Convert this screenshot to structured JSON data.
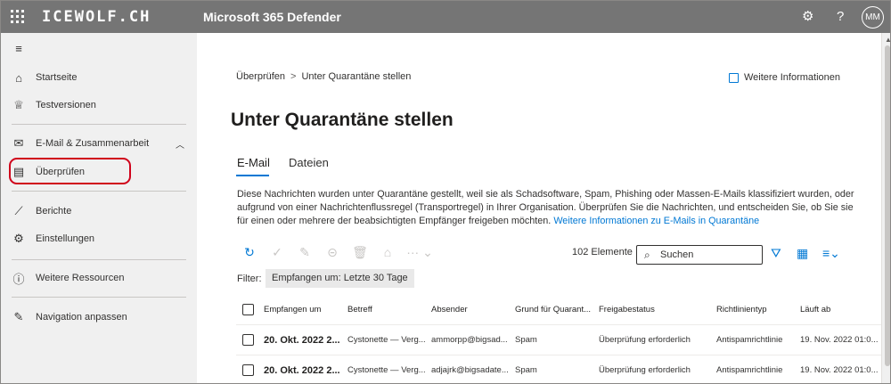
{
  "topbar": {
    "brand": "ICEWOLF.CH",
    "app_title": "Microsoft 365 Defender",
    "help_glyph": "?",
    "avatar_initials": "MM"
  },
  "sidebar": {
    "items": [
      {
        "label": "Startseite",
        "icon": "home-icon"
      },
      {
        "label": "Testversionen",
        "icon": "trophy-icon"
      },
      {
        "label": "E-Mail & Zusammenarbeit",
        "icon": "mail-icon"
      },
      {
        "label": "Überprüfen",
        "icon": "document-icon"
      },
      {
        "label": "Berichte",
        "icon": "chart-icon"
      },
      {
        "label": "Einstellungen",
        "icon": "gear-icon"
      },
      {
        "label": "Weitere Ressourcen",
        "icon": "info-icon"
      },
      {
        "label": "Navigation anpassen",
        "icon": "pencil-icon"
      }
    ],
    "highlight_color": "#d0021b"
  },
  "main": {
    "breadcrumb": {
      "parent": "Überprüfen",
      "current": "Unter Quarantäne stellen"
    },
    "more_info": "Weitere Informationen",
    "title": "Unter Quarantäne stellen",
    "tabs": [
      {
        "label": "E-Mail",
        "active": true
      },
      {
        "label": "Dateien",
        "active": false
      }
    ],
    "description": "Diese Nachrichten wurden unter Quarantäne gestellt, weil sie als Schadsoftware, Spam, Phishing oder Massen-E-Mails klassifiziert wurden, oder aufgrund von einer Nachrichtenflussregel (Transportregel) in Ihrer Organisation. Überprüfen Sie die Nachrichten, und entscheiden Sie, ob Sie sie für einen oder mehrere der beabsichtigten Empfänger freigeben möchten. ",
    "description_link": "Weitere Informationen zu E-Mails in Quarantäne",
    "item_count": "102 Elemente",
    "search_placeholder": "Suchen",
    "filter_label": "Filter:",
    "filter_chip": "Empfangen um: Letzte 30 Tage",
    "accent_color": "#0078d4"
  },
  "table": {
    "columns": [
      "Empfangen um",
      "Betreff",
      "Absender",
      "Grund für Quarant...",
      "Freigabestatus",
      "Richtlinientyp",
      "Läuft ab"
    ],
    "rows": [
      [
        "20. Okt. 2022 2...",
        "Cystonette — Verg...",
        "ammorpp@bigsad...",
        "Spam",
        "Überprüfung erforderlich",
        "Antispamrichtlinie",
        "19. Nov. 2022 01:0..."
      ],
      [
        "20. Okt. 2022 2...",
        "Cystonette — Verg...",
        "adjajrk@bigsadate...",
        "Spam",
        "Überprüfung erforderlich",
        "Antispamrichtlinie",
        "19. Nov. 2022 01:0..."
      ]
    ]
  }
}
